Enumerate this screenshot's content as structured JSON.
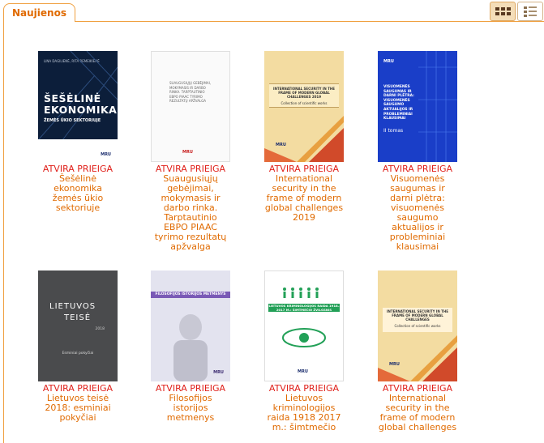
{
  "tab": {
    "label": "Naujienos"
  },
  "badge": "ATVIRA PRIEIGA",
  "books": [
    {
      "title": "Šešėlinė ekonomika žemės ūkio sektoriuje",
      "cover_lines": [
        "ŠEŠĖLINĖ",
        "EKONOMIKA"
      ],
      "cover_subtitle": "ŽEMĖS ŪKIO SEKTORIUJE",
      "cover_authors": "LINA DAGILIENĖ, RITA REMEIKIENĖ"
    },
    {
      "title": "Suaugusiųjų gebėjimai, mokymasis ir darbo rinka. Tarptautinio EBPO PIAAC tyrimo rezultatų apžvalga",
      "cover_text": "SUAUGUSIŲJŲ GEBĖJIMAI, MOKYMASIS IR DARBO RINKA. TARPTAUTINIO EBPO PIAAC TYRIMO REZULTATŲ APŽVALGA"
    },
    {
      "title": "International security in the frame of modern global challenges 2019",
      "cover_text": "INTERNATIONAL SECURITY IN THE FRAME OF MODERN GLOBAL CHALLENGES 2019",
      "cover_sub": "Collection of scientific works"
    },
    {
      "title": "Visuomenės saugumas ir darni plėtra: visuomenės saugumo aktualijos ir probleminiai klausimai",
      "cover_text": "VISUOMENĖS SAUGUMAS IR DARNI PLĖTRA: VISUOMENĖS SAUGUMO AKTUALIJOS IR PROBLEMINIAI KLAUSIMAI",
      "cover_volume": "II tomas"
    },
    {
      "title": "Lietuvos teisė 2018: esminiai pokyčiai",
      "cover_lines": [
        "LIETUVOS",
        "TEISĖ"
      ],
      "cover_year": "2018",
      "cover_sub": "Esminiai pokyčiai"
    },
    {
      "title": "Filosofijos istorijos metmenys",
      "cover_text": "FILOSOFIJOS ISTORIJOS METMENYS"
    },
    {
      "title": "Lietuvos kriminologijos raida 1918 2017 m.: šimtmečio",
      "cover_text": "LIETUVOS KRIMINOLOGIJOS RAIDA 1918–2017 M.: ŠIMTMEČIO ŽVILGSNIS"
    },
    {
      "title": "International security in the frame of modern global challenges",
      "cover_text": "INTERNATIONAL SECURITY IN THE FRAME OF MODERN GLOBAL CHALLENGES",
      "cover_sub": "Collection of scientific works"
    }
  ],
  "publisher_mark": "MRU",
  "icons": {
    "grid_view": "grid-view-icon",
    "list_view": "list-view-icon"
  },
  "colors": {
    "accent": "#e06a00",
    "badge": "#e0201a",
    "border": "#f0a040"
  }
}
